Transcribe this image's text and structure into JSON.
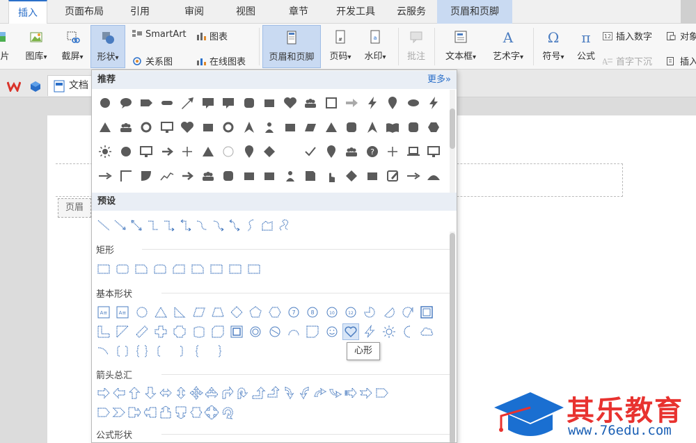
{
  "tabs": [
    "插入",
    "页面布局",
    "引用",
    "审阅",
    "视图",
    "章节",
    "开发工具",
    "云服务",
    "页眉和页脚"
  ],
  "active_tab": "插入",
  "ribbon": {
    "picture": "片",
    "gallery": "图库",
    "screenshot": "截屏",
    "shapes": "形状",
    "smartart": "SmartArt",
    "chart": "图表",
    "relation": "关系图",
    "online_chart": "在线图表",
    "header_footer": "页眉和页脚",
    "page_number": "页码",
    "watermark": "水印",
    "comment": "批注",
    "textbox": "文本框",
    "wordart": "艺术字",
    "symbol": "符号",
    "formula": "公式",
    "insert_number": "插入数字",
    "drop_cap": "首字下沉",
    "object": "对象",
    "insert": "插入",
    "dropdown_arrow": "▾"
  },
  "doc_tab": "文档",
  "header_tag": "页眉",
  "dropdown": {
    "recommend": "推荐",
    "more": "更多»",
    "preset": "预设",
    "rect": "矩形",
    "basic": "基本形状",
    "arrows": "箭头总汇",
    "formula": "公式形状"
  },
  "tooltip": "心形",
  "watermark": {
    "name": "其乐教育",
    "url": "www.76edu.com"
  },
  "colors": {
    "accent": "#2a6fc9",
    "selected": "#c9daf2",
    "shape_gray": "#5a5a5a",
    "outline_blue": "#4a7cc0",
    "watermark_red": "#e8322f",
    "watermark_blue": "#1a5fb4"
  }
}
